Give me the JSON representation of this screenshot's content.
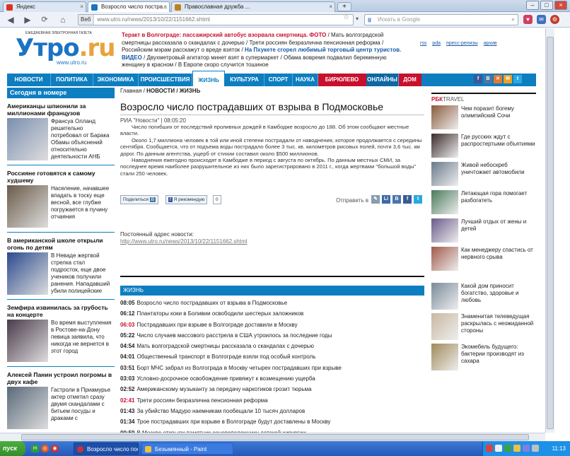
{
  "browser": {
    "tabs": [
      {
        "label": "Яндекс",
        "active": false
      },
      {
        "label": "Возросло число постра...",
        "active": true
      },
      {
        "label": "Православная дружба ...",
        "active": false
      }
    ],
    "new_tab": "+",
    "controls": {
      "minimize": "–",
      "maximize": "□",
      "close": "×"
    },
    "back": "◀",
    "forward": "▶",
    "home": "⌂",
    "address_site": "Веб",
    "address_url": "www.utro.ru/news/2013/10/22/1151662.shtml",
    "search_placeholder": "Искать в Google",
    "search_logo": "g",
    "search_go": "⌕",
    "star": "☆",
    "dropdown": "▾",
    "icons": [
      "♥",
      "✉",
      "⚙"
    ]
  },
  "site": {
    "logo_tagline": "ЕЖЕДНЕВНАЯ ЭЛЕКТРОННАЯ ГАЗЕТА",
    "logo_main": "Утро",
    "logo_dot": ".ru",
    "logo_sub": "www.utro.ru",
    "ticker": [
      {
        "text": "Теракт в Волгограде: пассажирский автобус взорвала смертница. ФОТО",
        "style": "red"
      },
      {
        "text": " / Мать волгоградской смертницы рассказала о скандалах с дочерью / Трети россиян безразлична пенсионная реформа / Российским мэрам расскажут о вреде взяток / ",
        "style": "plain"
      },
      {
        "text": "На Пхукете сгорел любимый торговый центр туристов. ВИДЕО",
        "style": "blue"
      },
      {
        "text": " / Двухметровый агитатор минет взят в супермаркет / Обама вовремя подвалил беременную женщину в красном / В Европе скоро случится тошиное",
        "style": "plain"
      }
    ],
    "toplinks": [
      "rss",
      "pda",
      "пресс-релизы",
      "архив"
    ]
  },
  "menu": [
    {
      "label": "НОВОСТИ",
      "width": 62,
      "style": ""
    },
    {
      "label": "ПОЛИТИКА",
      "width": 60,
      "style": ""
    },
    {
      "label": "ЭКОНОМИКА",
      "width": 64,
      "style": ""
    },
    {
      "label": "ПРОИСШЕСТВИЯ",
      "width": 76,
      "style": ""
    },
    {
      "label": "ЖИЗНЬ",
      "width": 46,
      "style": "active"
    },
    {
      "label": "КУЛЬТУРА",
      "width": 56,
      "style": ""
    },
    {
      "label": "СПОРТ",
      "width": 40,
      "style": ""
    },
    {
      "label": "НАУКА",
      "width": 36,
      "style": ""
    },
    {
      "label": "БИРЮЛЕВО",
      "width": 68,
      "style": "red"
    },
    {
      "label": "ОНЛАЙНЫ",
      "width": 46,
      "style": "dark"
    },
    {
      "label": "ДОМ",
      "width": 32,
      "style": "red"
    }
  ],
  "social": [
    {
      "label": "f",
      "color": "#3b5998"
    },
    {
      "label": "В",
      "color": "#4a76a8"
    },
    {
      "label": "✕",
      "color": "#e6772e"
    },
    {
      "label": "✉",
      "color": "#f0a020"
    },
    {
      "label": "t",
      "color": "#2aa9e0"
    }
  ],
  "left": {
    "heading": "Сегодня в номере",
    "articles": [
      {
        "title": "Американцы шпионили за миллионами французов",
        "text": "Франсуа Олланд решительно потребовал от Барака Обамы объяснений относительно деятельности АНБ",
        "color": "#7b8fb0"
      },
      {
        "title": "Россияне готовятся к самому худшему",
        "text": "Население, начавшее впадать в тоску еще весной, все глубже погружается в пучину отчаяния",
        "color": "#6b5a4a"
      },
      {
        "title": "В американской школе открыли огонь по детям",
        "text": "В Неваде жертвой стрелка стал подросток, еще двое учеников получили ранения. Нападавший убили полицейские",
        "color": "#2b4a8e"
      },
      {
        "title": "Земфира извинилась за грубость на концерте",
        "text": "Во время выступления в Ростове-на-Дону певица заявила, что никогда не вернется в этот город",
        "color": "#4a3a4a"
      },
      {
        "title": "Алексей Панин устроил погромы в двух кафе",
        "text": "Гастроли в Приамурье актер отметил сразу двумя скандалами с битьем посуды и драками с",
        "color": "#5a6a7a"
      }
    ]
  },
  "article": {
    "crumb_home": "Главная",
    "crumb_section": "НОВОСТИ / ЖИЗНЬ",
    "title": "Возросло число пострадавших от взрыва в Подмосковье",
    "meta": "РИА \"Новости\" | 08:05:20",
    "paragraphs": [
      "Число погибших от последствий проливных дождей в Камбодже возросло до 188. Об этом сообщают местные власти.",
      "Около 1,7 миллиона человек в той или иной степени пострадали от наводнения, которое продолжается с середины сентября. Сообщается, что от подъема воды пострадало более 3 тыс. кв. километров рисовых полей, почти 3,6 тыс. км дорог. По данным агентства, ущерб от стихии составил около $500 миллионов.",
      "Наводнения ежегодно происходят в Камбодже в период с августа по октябрь. По данным местных СМИ, за последнее время наиболее разрушительное из них было зарегистрировано в 2011 г., когда жертвами \"большой воды\" стали 250 человек."
    ],
    "share_vk": "Поделиться",
    "share_vk_icon": "В",
    "share_fb": "Я рекомендую",
    "share_fb_icon": "f",
    "share_fb_count": "0",
    "send_to": "Отправить в",
    "share_icons": [
      {
        "label": "✎",
        "color": "#8a9bb0"
      },
      {
        "label": "Li",
        "color": "#3a6aa8"
      },
      {
        "label": "В",
        "color": "#4a76a8"
      },
      {
        "label": "f",
        "color": "#3b5998"
      },
      {
        "label": "t",
        "color": "#2aa9e0"
      }
    ],
    "permalink_label": "Постоянный адрес новости:",
    "permalink_url": "http://www.utro.ru/news/2013/10/22/1151662.shtml"
  },
  "zhizn": {
    "heading": "ЖИЗНЬ",
    "items": [
      {
        "time": "08:05",
        "title": "Возросло число пострадавших от взрыва в Подмосковье",
        "red": false
      },
      {
        "time": "06:12",
        "title": "Плантаторы коки в Боливии освободили шестерых заложников",
        "red": false
      },
      {
        "time": "06:03",
        "title": "Пострадавших при взрыве в Волгограде доставили в Москву",
        "red": true
      },
      {
        "time": "05:22",
        "title": "Число случаев массового расстрела в США утроилось за последние годы",
        "red": false
      },
      {
        "time": "04:54",
        "title": "Мать волгоградской смертницы рассказала о скандалах с дочерью",
        "red": false
      },
      {
        "time": "04:01",
        "title": "Общественный транспорт в Волгограде взяли под особый контроль",
        "red": false
      },
      {
        "time": "03:51",
        "title": "Борт МЧС забрал из Волгограда в Москву четырех пострадавших при взрыве",
        "red": false
      },
      {
        "time": "03:03",
        "title": "Условно-досрочное освобождение привяжут к возмещению ущерба",
        "red": false
      },
      {
        "time": "02:52",
        "title": "Американскому музыканту за передачу наркотиков грозит тюрьма",
        "red": false
      },
      {
        "time": "02:41",
        "title": "Трети россиян безразлична пенсионная реформа",
        "red": true
      },
      {
        "time": "01:43",
        "title": "За убийство Мадуро наемникам пообещали 10 тысяч долларов",
        "red": false
      },
      {
        "time": "01:34",
        "title": "Трое пострадавших при взрыве в Волгограде будут доставлены в Москву",
        "red": false
      },
      {
        "time": "00:59",
        "title": "В Москве открыли памятник основоположнику детской хирургии",
        "red": false
      }
    ]
  },
  "right": {
    "brand": "РБК",
    "brand_sub": "TRAVEL",
    "top": [
      {
        "text": "Чем поразит богему олимпийский Сочи",
        "color": "#8a5a3a"
      },
      {
        "text": "Где русских ждут с распростертыми объятиями",
        "color": "#3a2a2a"
      },
      {
        "text": "Живой небоскреб уничтожает автомобили",
        "color": "#6a7a8a"
      },
      {
        "text": "Летающая гора помогает разбогатеть",
        "color": "#4a7a5a"
      },
      {
        "text": "Лучший отдых от жены и детей",
        "color": "#6a5a8a"
      },
      {
        "text": "Как менеджеру спастись от нервного срыва",
        "color": "#a05a4a"
      }
    ],
    "bottom": [
      {
        "text": "Какой дом приносит богатство, здоровье и любовь",
        "color": "#7a8a9a"
      },
      {
        "text": "Знаменитая телеведущая раскрылась с неожиданной стороны",
        "color": "#c8b8a0"
      },
      {
        "text": "Экомебель будущего: бактерии производят из сахара",
        "color": "#a08a5a"
      }
    ]
  },
  "taskbar": {
    "start": "пуск",
    "quicklaunch": [
      "H",
      "◎",
      "◉"
    ],
    "tasks": [
      {
        "label": "Возросло число пост...",
        "active": true
      },
      {
        "label": "Безымянный - Paint",
        "active": false
      }
    ],
    "clock": "11:13"
  }
}
